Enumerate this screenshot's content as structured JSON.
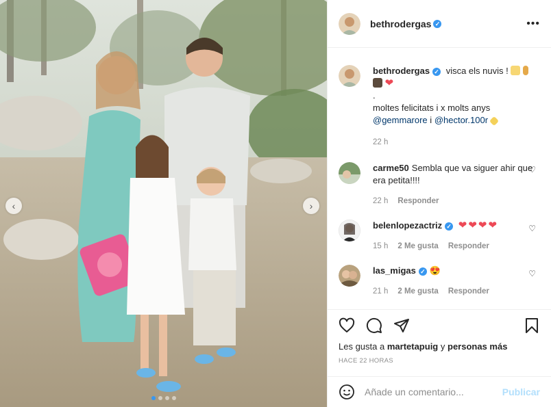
{
  "post": {
    "username": "bethrodergas",
    "more_label": "•••",
    "caption": {
      "username": "bethrodergas",
      "line1": "visca els nuvis !",
      "dot": ".",
      "line2": "moltes felicitats i x molts anys",
      "mention1": "@gemmarore",
      "conj": "i",
      "mention2": "@hector.100r",
      "time": "22 h"
    }
  },
  "comments": [
    {
      "username": "carme50",
      "text": "Sembla que va siguer ahir que era petita!!!!",
      "time": "22 h",
      "likes": "",
      "reply": "Responder"
    },
    {
      "username": "belenlopezactriz",
      "text": "❤❤❤❤",
      "time": "15 h",
      "likes": "2 Me gusta",
      "reply": "Responder"
    },
    {
      "username": "las_migas",
      "text": "😍",
      "time": "21 h",
      "likes": "2 Me gusta",
      "reply": "Responder"
    }
  ],
  "likes": {
    "prefix": "Les gusta a",
    "user": "martetapuig",
    "middle": "y",
    "rest": "personas más"
  },
  "timeago": "HACE 22 HORAS",
  "add_comment": {
    "placeholder": "Añade un comentario...",
    "publish": "Publicar"
  },
  "carousel": {
    "total": 4,
    "active": 1
  },
  "colors": {
    "verified": "#3897f0",
    "heart": "#ed4956",
    "publish_disabled": "#b2dffc",
    "link": "#00376b"
  },
  "icons": [
    "chevron-left-icon",
    "chevron-right-icon",
    "heart-icon",
    "comment-icon",
    "share-icon",
    "bookmark-icon",
    "emoji-icon",
    "verified-icon"
  ]
}
